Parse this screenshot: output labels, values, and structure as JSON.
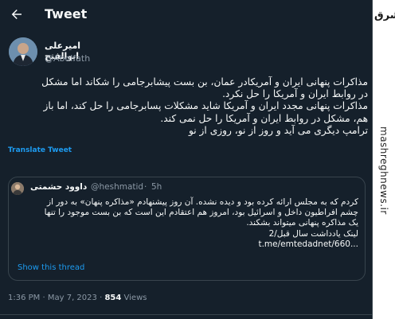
{
  "header": {
    "title": "Tweet",
    "back_icon": "arrow-left-icon"
  },
  "author": {
    "name": "امیرعلی ابوالفتح",
    "handle": "@Abolfath"
  },
  "tweet": {
    "lines": [
      "مذاکرات پنهانی ایران و آمریکادر عمان، بن بست پیشابرجامی را شکاند اما مشکل",
      "در روابط ایران و آمریکا را حل نکرد.",
      "مذاکرات پنهانی مجدد ایران و آمریکا شاید مشکلات پسابرجامی را حل کند، اما باز",
      "هم، مشکل در روابط ایران و آمریکا را حل نمی کند.",
      "ترامپ دیگری می آید و روز از نو، روزی از نو"
    ],
    "translate_label": "Translate Tweet"
  },
  "quote": {
    "name": "داوود حشمتی",
    "handle": "@heshmatid",
    "separator": "·",
    "time": "5h",
    "lines": [
      "کردم که به مجلس ارائه کرده بود و دیده نشده. آن روز پیشنهادم «مذاکره پنهان» به دور از",
      "چشم افراطیون داخل و اسرائیل بود، امروز هم اعتقادم این است که بن بست موجود را تنها",
      "یک مذاکره پنهانی میتواند بشکند.",
      "لینک یادداشت سال قبل/2",
      "t.me/emtedadnet/660..."
    ],
    "show_thread_label": "Show this thread"
  },
  "meta": {
    "time": "1:36 PM",
    "dot1": "·",
    "date": "May 7, 2023",
    "dot2": "·",
    "views_count": "854",
    "views_label": "Views"
  },
  "watermark": {
    "text": "mashreghnews.ir",
    "logo_text": "مشرق"
  },
  "colors": {
    "background": "#15202b",
    "accent": "#1d9bf0",
    "muted": "#8b98a5",
    "border": "#38444d"
  }
}
